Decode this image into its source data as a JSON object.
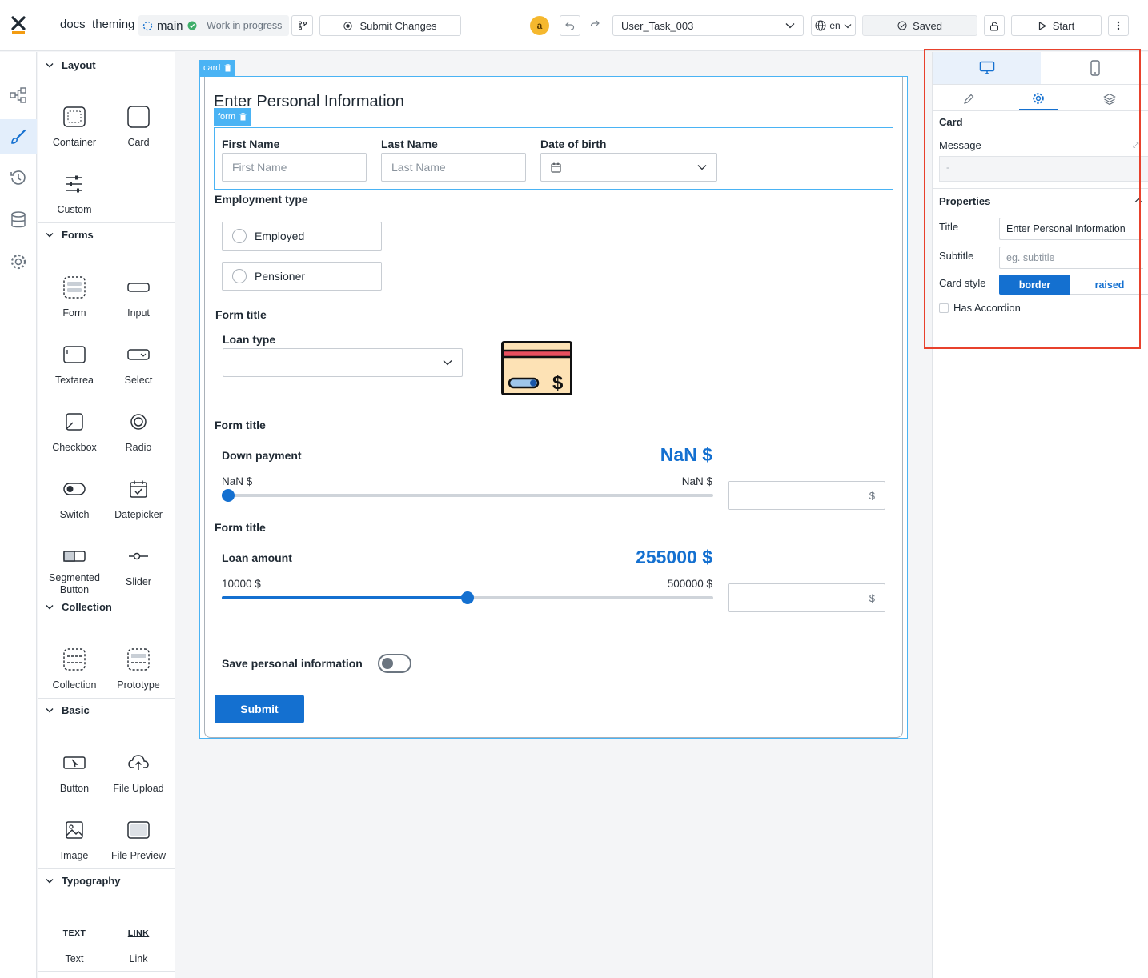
{
  "app": {
    "project": "docs_theming",
    "branch": "main",
    "status": "- Work in progress",
    "submit_label": "Submit Changes",
    "avatar": "a",
    "task": "User_Task_003",
    "lang": "en",
    "saved": "Saved",
    "start": "Start"
  },
  "components": {
    "sections": [
      {
        "title": "Layout",
        "items": [
          "Container",
          "Card",
          "Custom"
        ]
      },
      {
        "title": "Forms",
        "items": [
          "Form",
          "Input",
          "Textarea",
          "Select",
          "Checkbox",
          "Radio",
          "Switch",
          "Datepicker",
          "Segmented Button",
          "Slider"
        ]
      },
      {
        "title": "Collection",
        "items": [
          "Collection",
          "Prototype"
        ]
      },
      {
        "title": "Basic",
        "items": [
          "Button",
          "File Upload",
          "Image",
          "File Preview"
        ]
      },
      {
        "title": "Typography",
        "items": [
          "Text",
          "Link"
        ]
      }
    ],
    "text_icon": "TEXT",
    "link_icon": "LINK"
  },
  "canvas": {
    "card_tag": "card",
    "form_tag": "form",
    "title": "Enter Personal Information",
    "first_name_label": "First Name",
    "first_name_placeholder": "First Name",
    "last_name_label": "Last Name",
    "last_name_placeholder": "Last Name",
    "dob_label": "Date of birth",
    "employment_label": "Employment type",
    "employment_options": [
      "Employed",
      "Pensioner"
    ],
    "form_title_1": "Form title",
    "loan_type_label": "Loan type",
    "form_title_2": "Form title",
    "down_payment": {
      "label": "Down payment",
      "value": "NaN $",
      "min": "NaN $",
      "max": "NaN $",
      "unit": "$",
      "fraction": 0.0
    },
    "form_title_3": "Form title",
    "loan_amount": {
      "label": "Loan amount",
      "value": "255000 $",
      "min": "10000 $",
      "max": "500000 $",
      "unit": "$",
      "fraction": 0.5
    },
    "save_info_label": "Save personal information",
    "submit_label": "Submit"
  },
  "properties": {
    "section_card": "Card",
    "message_label": "Message",
    "message_value": "-",
    "section_props": "Properties",
    "title_label": "Title",
    "title_value": "Enter Personal Information",
    "subtitle_label": "Subtitle",
    "subtitle_placeholder": "eg. subtitle",
    "card_style_label": "Card style",
    "card_style_options": [
      "border",
      "raised"
    ],
    "has_accordion_label": "Has Accordion"
  },
  "colors": {
    "accent": "#1470d0",
    "tag": "#4ab3f4",
    "highlight": "#e8412c",
    "brand": "#f39c12"
  }
}
